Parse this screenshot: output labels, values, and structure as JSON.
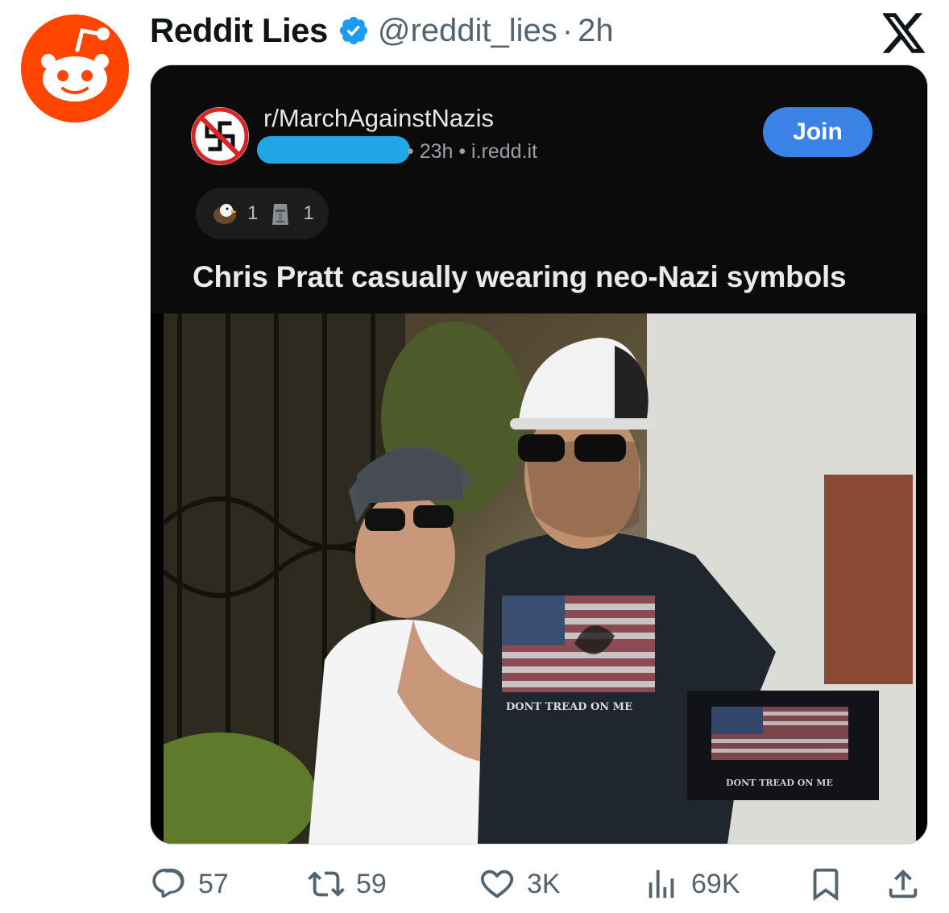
{
  "tweet": {
    "author_name": "Reddit Lies",
    "handle": "@reddit_lies",
    "separator": "·",
    "time": "2h",
    "avatar_icon": "reddit-snoo-icon",
    "verified_color": "#1d9bf0"
  },
  "reddit_post": {
    "subreddit": "r/MarchAgainstNazis",
    "meta": "• 23h • i.redd.it",
    "join_label": "Join",
    "awards": [
      {
        "icon": "eagle-award-icon",
        "count": "1"
      },
      {
        "icon": "moai-award-icon",
        "count": "1"
      }
    ],
    "title": "Chris Pratt casually wearing neo-Nazi symbols",
    "shirt_text": "DONT TREAD ON ME",
    "inset_text": "DONT TREAD ON ME"
  },
  "actions": {
    "replies": "57",
    "reposts": "59",
    "likes": "3K",
    "views": "69K"
  },
  "colors": {
    "reddit_orange": "#ff4500",
    "join_blue": "#3b82e6",
    "redaction": "#22a7e6",
    "icon_gray": "#536471"
  }
}
